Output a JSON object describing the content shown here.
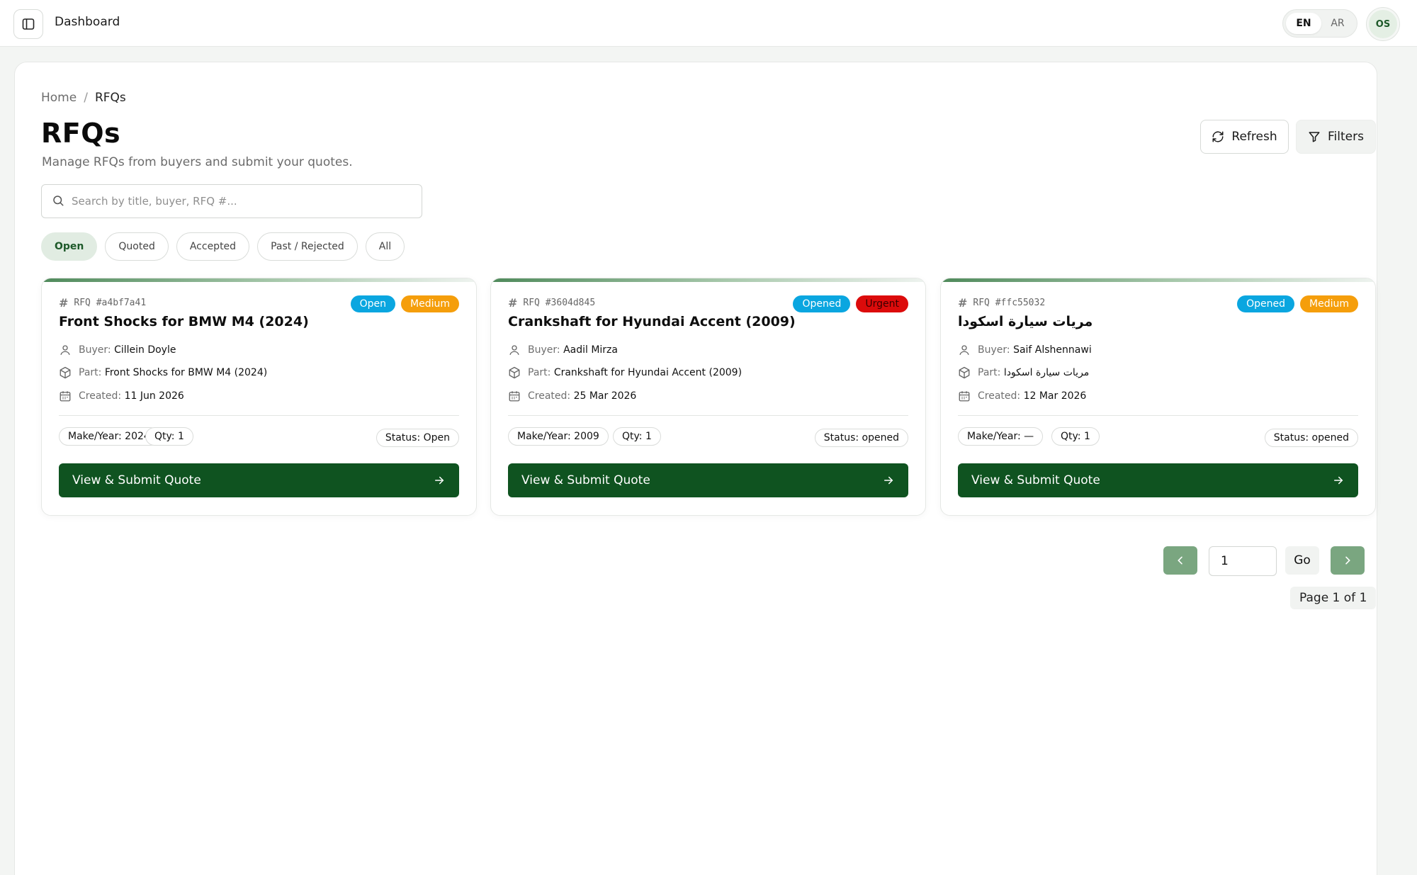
{
  "topbar": {
    "title": "Dashboard",
    "lang_en": "EN",
    "lang_ar": "AR",
    "avatar_initials": "OS"
  },
  "breadcrumb": {
    "home": "Home",
    "separator": "/",
    "current": "RFQs"
  },
  "header": {
    "title": "RFQs",
    "subtitle": "Manage RFQs from buyers and submit your quotes.",
    "refresh_label": "Refresh",
    "filters_label": "Filters"
  },
  "search": {
    "placeholder": "Search by title, buyer, RFQ #...",
    "value": ""
  },
  "tabs": [
    {
      "label": "Open",
      "active": true
    },
    {
      "label": "Quoted",
      "active": false
    },
    {
      "label": "Accepted",
      "active": false
    },
    {
      "label": "Past / Rejected",
      "active": false
    },
    {
      "label": "All",
      "active": false
    }
  ],
  "labels": {
    "buyer": "Buyer:",
    "part": "Part:",
    "created": "Created:",
    "cta": "View & Submit Quote"
  },
  "cards": [
    {
      "rfq_id": "RFQ #a4bf7a41",
      "title": "Front Shocks for BMW M4 (2024)",
      "status_badge": "Open",
      "priority_badge": "Medium",
      "buyer": "Cillein Doyle",
      "part": "Front Shocks for BMW M4 (2024)",
      "created": "11 Jun 2026",
      "make_year": "Make/Year: 2024",
      "qty": "Qty: 1",
      "status_chip": "Status: Open"
    },
    {
      "rfq_id": "RFQ #3604d845",
      "title": "Crankshaft for Hyundai Accent (2009)",
      "status_badge": "Opened",
      "priority_badge": "Urgent",
      "buyer": "Aadil Mirza",
      "part": "Crankshaft for Hyundai Accent (2009)",
      "created": "25 Mar 2026",
      "make_year": "Make/Year: 2009",
      "qty": "Qty: 1",
      "status_chip": "Status: opened"
    },
    {
      "rfq_id": "RFQ #ffc55032",
      "title": "مريات سيارة اسكودا",
      "status_badge": "Opened",
      "priority_badge": "Medium",
      "buyer": "Saif Alshennawi",
      "part": "مريات سيارة اسكودا",
      "created": "12 Mar 2026",
      "make_year": "Make/Year: —",
      "qty": "Qty: 1",
      "status_chip": "Status: opened"
    }
  ],
  "pagination": {
    "page_value": "1",
    "go_label": "Go",
    "info": "Page 1 of 1"
  },
  "colors": {
    "brand_green": "#0f5320",
    "status_blue": "#0aa6e0",
    "medium_orange": "#f59e0b",
    "urgent_red": "#dc0b0b"
  }
}
